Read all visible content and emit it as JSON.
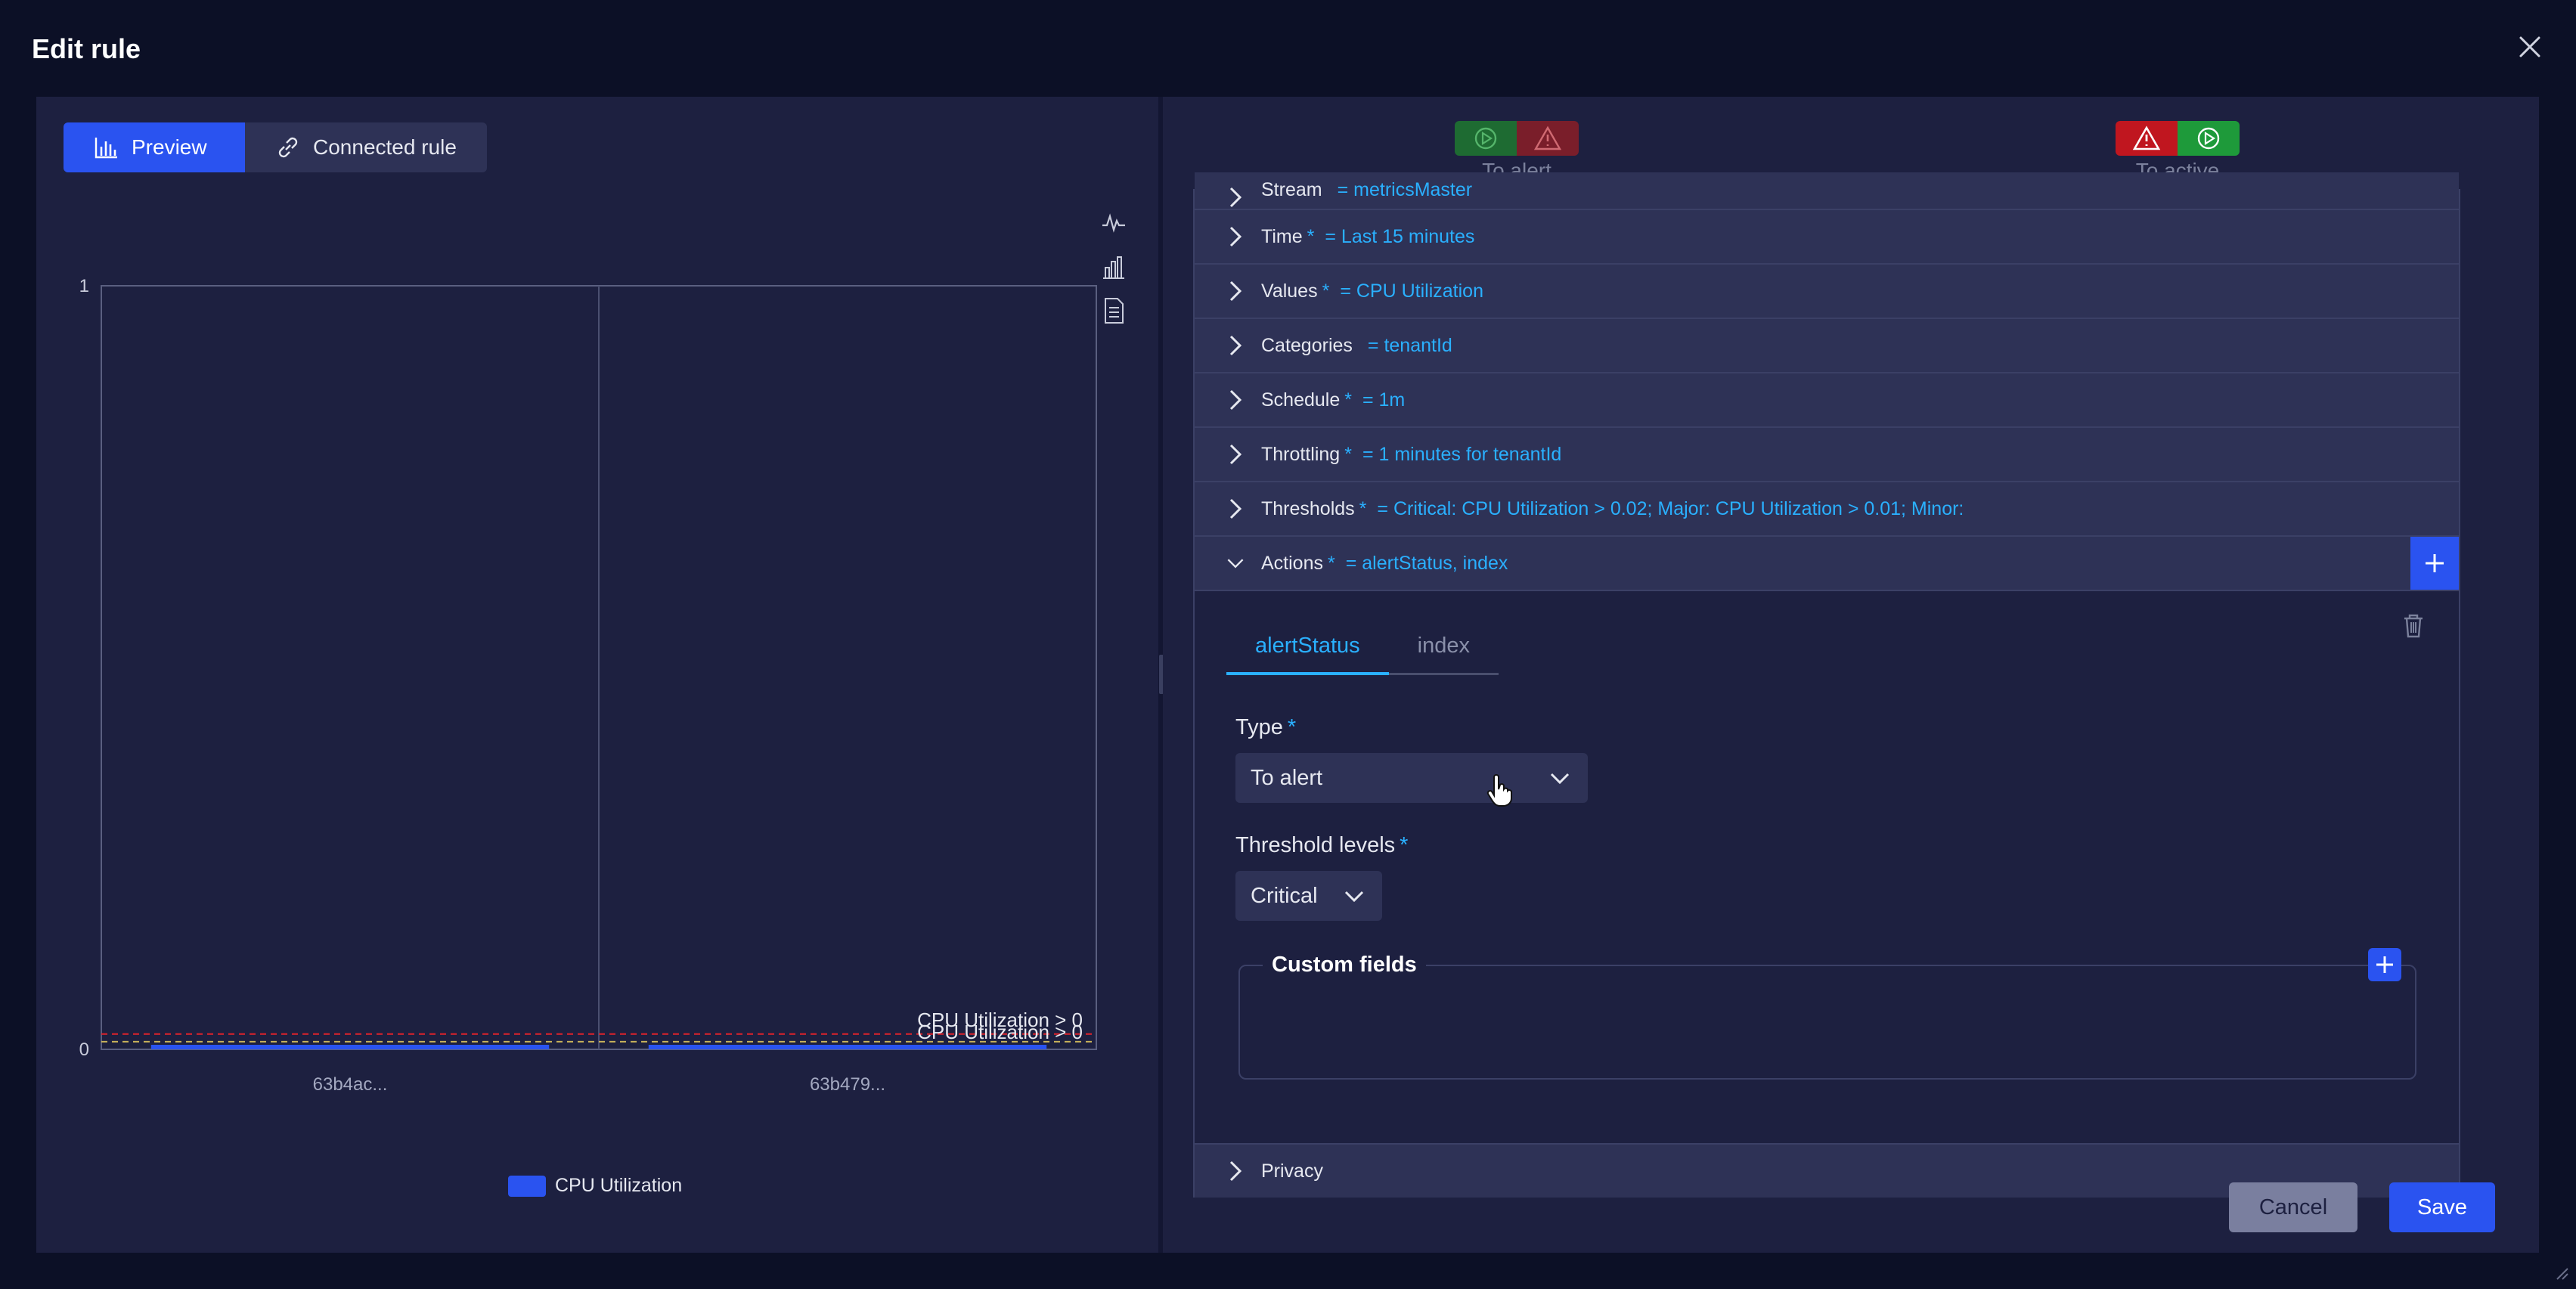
{
  "modal": {
    "title": "Edit rule"
  },
  "left_tabs": {
    "preview": "Preview",
    "connected_rule": "Connected rule"
  },
  "status": {
    "to_alert": "To alert",
    "to_active": "To active",
    "colors": {
      "green": "#1e7a35",
      "red": "#c0161f"
    }
  },
  "accordion": [
    {
      "label": "Stream",
      "required": "",
      "value": "= metricsMaster"
    },
    {
      "label": "Time",
      "required": "*",
      "value": "= Last 15 minutes"
    },
    {
      "label": "Values",
      "required": "*",
      "value": "= CPU Utilization"
    },
    {
      "label": "Categories",
      "required": "",
      "value": "= tenantId"
    },
    {
      "label": "Schedule",
      "required": "*",
      "value": "= 1m"
    },
    {
      "label": "Throttling",
      "required": "*",
      "value": "= 1 minutes for tenantId"
    },
    {
      "label": "Thresholds",
      "required": "*",
      "value": "= Critical: CPU Utilization > 0.02; Major: CPU Utilization > 0.01; Minor:"
    },
    {
      "label": "Actions",
      "required": "*",
      "value": "= alertStatus, index"
    },
    {
      "label": "Privacy",
      "required": "",
      "value": ""
    }
  ],
  "actions": {
    "tabs": [
      "alertStatus",
      "index"
    ],
    "type_label": "Type",
    "type_value": "To alert",
    "threshold_label": "Threshold levels",
    "threshold_value": "Critical",
    "required_mark": "*",
    "custom_fields_label": "Custom fields"
  },
  "buttons": {
    "cancel": "Cancel",
    "save": "Save"
  },
  "chart_data": {
    "type": "bar",
    "categories": [
      "63b4ac...",
      "63b479..."
    ],
    "series": [
      {
        "name": "CPU Utilization",
        "values": [
          0,
          0
        ]
      }
    ],
    "ylim": [
      0,
      1
    ],
    "yticks": [
      "0",
      "1"
    ],
    "threshold_lines": [
      {
        "label": "CPU Utilization > 0",
        "value": 0.02,
        "color": "#e0222a"
      },
      {
        "label": "CPU Utilization > 0",
        "value": 0.01,
        "color": "#c9b35a"
      }
    ],
    "legend": "bottom",
    "colors": {
      "bar": "#2a53f0"
    }
  }
}
